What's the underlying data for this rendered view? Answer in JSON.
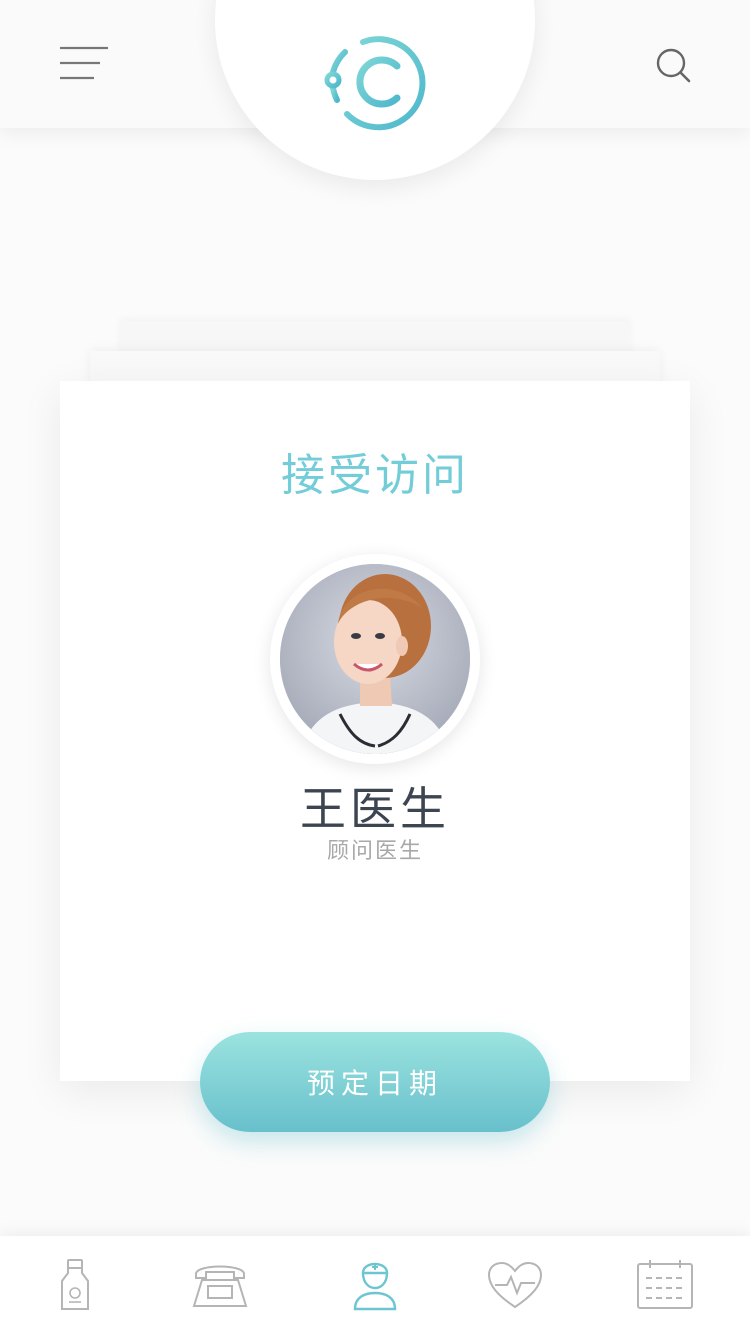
{
  "header": {
    "menu_icon": "hamburger-menu-icon",
    "logo_icon": "clinic-c-logo-icon",
    "search_icon": "search-icon"
  },
  "card": {
    "title": "接受访问",
    "doctor": {
      "name": "王医生",
      "role": "顾问医生",
      "avatar_icon": "doctor-avatar"
    }
  },
  "book_button": {
    "label": "预定日期"
  },
  "tabbar": {
    "items": [
      {
        "icon": "medicine-bottle-icon",
        "active": false
      },
      {
        "icon": "telephone-icon",
        "active": false
      },
      {
        "icon": "nurse-icon",
        "active": true
      },
      {
        "icon": "heart-pulse-icon",
        "active": false
      },
      {
        "icon": "calendar-icon",
        "active": false
      }
    ]
  },
  "colors": {
    "accent": "#72cdd8",
    "button_top": "#9be3df",
    "button_bottom": "#68c0cc",
    "inactive_icon": "#b5b5b5",
    "text_dark": "#3c4550",
    "text_muted": "#a8a8a8"
  }
}
